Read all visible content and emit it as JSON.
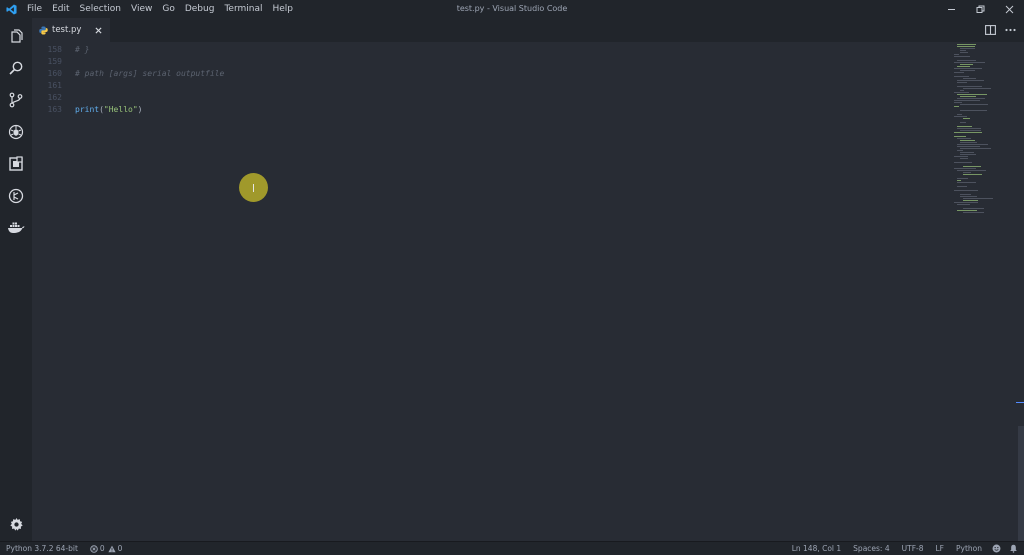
{
  "window": {
    "title": "test.py - Visual Studio Code"
  },
  "menu": [
    "File",
    "Edit",
    "Selection",
    "View",
    "Go",
    "Debug",
    "Terminal",
    "Help"
  ],
  "tab": {
    "label": "test.py"
  },
  "editor": {
    "lines": [
      {
        "num": "158",
        "text": "# }"
      },
      {
        "num": "159",
        "text": ""
      },
      {
        "num": "160",
        "text": "# path [args] serial outputfile"
      },
      {
        "num": "161",
        "text": ""
      },
      {
        "num": "162",
        "text": ""
      },
      {
        "num": "163",
        "fn": "print",
        "open": "(",
        "str": "\"Hello\"",
        "close": ")"
      }
    ]
  },
  "statusbar": {
    "interpreter": "Python 3.7.2 64-bit",
    "errors": "0",
    "warnings": "0",
    "position": "Ln 148, Col 1",
    "spaces": "Spaces: 4",
    "encoding": "UTF-8",
    "eol": "LF",
    "language": "Python"
  },
  "icons": {
    "activity": [
      "files-icon",
      "search-icon",
      "source-control-icon",
      "debug-icon",
      "extensions-icon",
      "gitlens-icon",
      "docker-icon"
    ],
    "settings": "gear-icon"
  },
  "colors": {
    "background": "#282c34",
    "chrome": "#21252b",
    "accent": "#528bff"
  }
}
